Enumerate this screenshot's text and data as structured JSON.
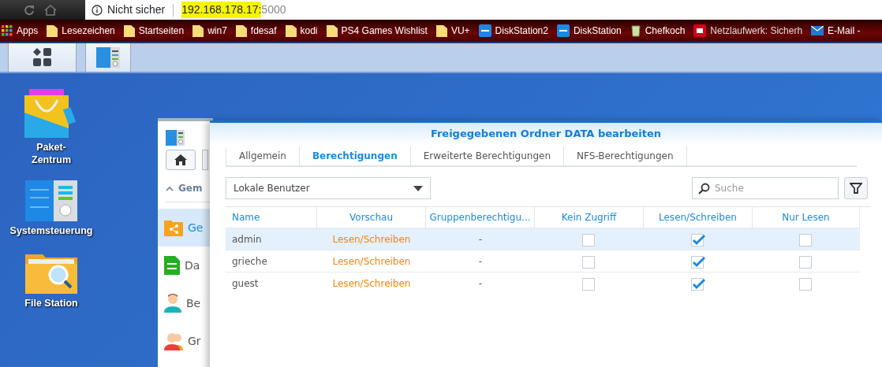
{
  "browser": {
    "security_label": "Nicht sicher",
    "url_host": "192.168.178.17:",
    "url_host_highlighted": true,
    "url_port": "5000"
  },
  "bookmarks": [
    {
      "kind": "apps",
      "label": "Apps"
    },
    {
      "kind": "folder",
      "label": "Lesezeichen"
    },
    {
      "kind": "folder",
      "label": "Startseiten"
    },
    {
      "kind": "folder",
      "label": "win7"
    },
    {
      "kind": "folder",
      "label": "fdesaf"
    },
    {
      "kind": "folder",
      "label": "kodi"
    },
    {
      "kind": "folder",
      "label": "PS4 Games Wishlist"
    },
    {
      "kind": "folder",
      "label": "VU+"
    },
    {
      "kind": "dsm",
      "label": "DiskStation2"
    },
    {
      "kind": "dsm",
      "label": "DiskStation"
    },
    {
      "kind": "chef",
      "label": "Chefkoch"
    },
    {
      "kind": "pc",
      "label": "Netzlaufwerk: Sicherh"
    },
    {
      "kind": "mail",
      "label": "E-Mail -"
    }
  ],
  "desktop_icons": [
    {
      "kind": "package",
      "label": "Paket-Zentrum"
    },
    {
      "kind": "control-panel",
      "label": "Systemsteuerung"
    },
    {
      "kind": "file-station",
      "label": "File Station"
    }
  ],
  "background_window": {
    "section": "Gem",
    "items": [
      {
        "kind": "shared-folder",
        "label": "Ge",
        "selected": true
      },
      {
        "kind": "file-services",
        "label": "Da",
        "selected": false
      },
      {
        "kind": "user",
        "label": "Be",
        "selected": false
      },
      {
        "kind": "group",
        "label": "Gr",
        "selected": false
      }
    ]
  },
  "dialog": {
    "title": "Freigegebenen Ordner DATA bearbeiten",
    "tabs": [
      {
        "label": "Allgemein",
        "selected": false
      },
      {
        "label": "Berechtigungen",
        "selected": true
      },
      {
        "label": "Erweiterte Berechtigungen",
        "selected": false
      },
      {
        "label": "NFS-Berechtigungen",
        "selected": false
      }
    ],
    "user_type": "Lokale Benutzer",
    "search": {
      "placeholder": "Suche"
    },
    "table": {
      "columns": [
        "Name",
        "Vorschau",
        "Gruppenberechtigu...",
        "Kein Zugriff",
        "Lesen/Schreiben",
        "Nur Lesen"
      ],
      "rows": [
        {
          "name": "admin",
          "preview": "Lesen/Schreiben",
          "group_permission": "-",
          "no_access": false,
          "read_write": true,
          "read_only": false,
          "selected": true
        },
        {
          "name": "grieche",
          "preview": "Lesen/Schreiben",
          "group_permission": "-",
          "no_access": false,
          "read_write": true,
          "read_only": false,
          "selected": false
        },
        {
          "name": "guest",
          "preview": "Lesen/Schreiben",
          "group_permission": "-",
          "no_access": false,
          "read_write": true,
          "read_only": false,
          "selected": false
        }
      ]
    }
  }
}
